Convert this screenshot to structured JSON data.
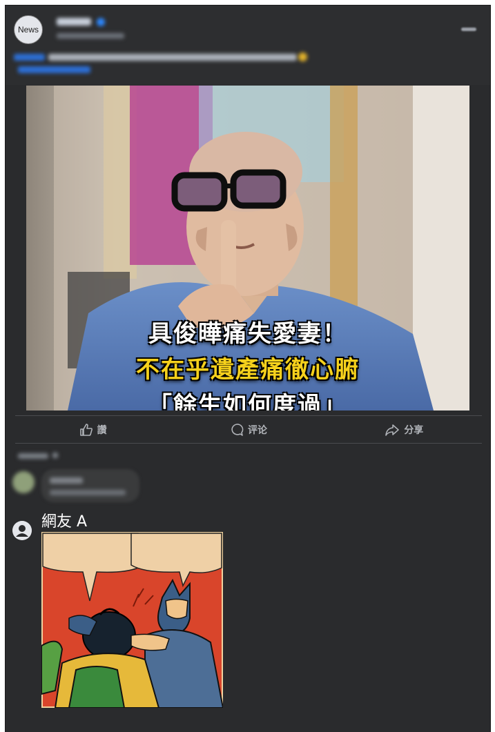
{
  "header": {
    "avatar_label": "News"
  },
  "post_image": {
    "caption_line1": "具俊曄痛失愛妻！",
    "caption_line2": "不在乎遺產痛徹心腑",
    "caption_line3": "「餘生如何度過」"
  },
  "actions": {
    "like": "讚",
    "comment": "评论",
    "share": "分享"
  },
  "comment": {
    "user_name": "網友 A"
  },
  "colors": {
    "post_background": "#2a2b2d",
    "action_text": "#b0b3b8",
    "caption_yellow": "#f6d11c"
  }
}
